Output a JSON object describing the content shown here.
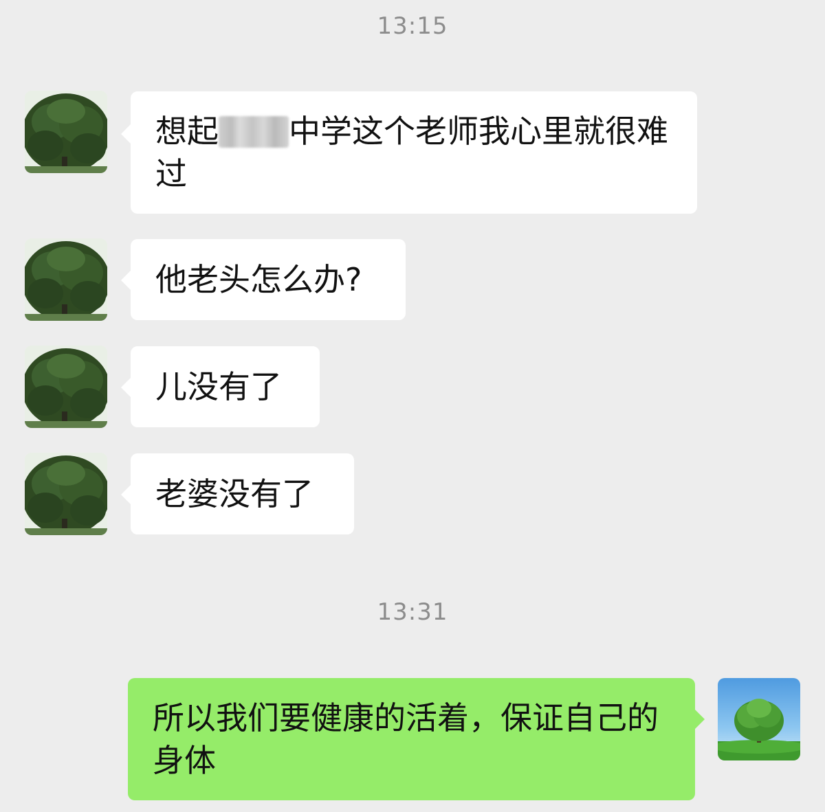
{
  "timestamps": [
    "13:15",
    "13:31"
  ],
  "messages": [
    {
      "sender": "contact",
      "avatar": "tree-avatar",
      "text_before": "想起",
      "redacted": true,
      "text_after": "中学这个老师我心里就很难过"
    },
    {
      "sender": "contact",
      "avatar": "tree-avatar",
      "text": "他老头怎么办?"
    },
    {
      "sender": "contact",
      "avatar": "tree-avatar",
      "text": "儿没有了"
    },
    {
      "sender": "contact",
      "avatar": "tree-avatar",
      "text": "老婆没有了"
    },
    {
      "sender": "me",
      "avatar": "tree-sky-avatar",
      "text": "所以我们要健康的活着，保证自己的身体"
    }
  ],
  "colors": {
    "background": "#ededed",
    "incoming_bubble": "#ffffff",
    "outgoing_bubble": "#95ec69",
    "timestamp_text": "#8c8c8c"
  }
}
